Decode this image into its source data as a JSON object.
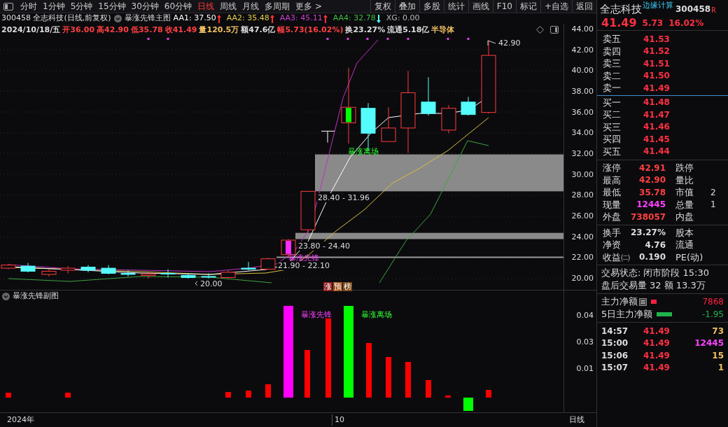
{
  "toolbar": {
    "periods": [
      {
        "label": "分时",
        "selected": false
      },
      {
        "label": "1分钟",
        "selected": false
      },
      {
        "label": "5分钟",
        "selected": false
      },
      {
        "label": "15分钟",
        "selected": false
      },
      {
        "label": "30分钟",
        "selected": false
      },
      {
        "label": "60分钟",
        "selected": false
      },
      {
        "label": "日线",
        "selected": true
      },
      {
        "label": "周线",
        "selected": false
      },
      {
        "label": "月线",
        "selected": false
      },
      {
        "label": "多周期",
        "selected": false
      },
      {
        "label": "更多 >",
        "selected": false
      }
    ],
    "actions": [
      "复权",
      "叠加",
      "多股",
      "统计",
      "画线",
      "F10",
      "标记",
      "+自选",
      "返回"
    ]
  },
  "info": {
    "title": "300458 全志科技(日线,前复权)",
    "indicator": "暴涨先锋主图",
    "values": [
      {
        "text": "AA1: 37.50",
        "color": "#ffffff",
        "rising": true
      },
      {
        "text": "AA2: 35.48",
        "color": "#e6d14a",
        "rising": true
      },
      {
        "text": "AA3: 45.11",
        "color": "#d13dd1",
        "rising": true
      },
      {
        "text": "AA4: 32.78",
        "color": "#3fbf3f",
        "rising": false
      },
      {
        "text": "XG: 0.00",
        "color": "#bbbbbb"
      }
    ],
    "quote": [
      {
        "text": "2024/10/18/五",
        "color": "#dddddd"
      },
      {
        "text": "开36.00",
        "color": "#ff4040"
      },
      {
        "text": "高42.90",
        "color": "#ff4040"
      },
      {
        "text": "低35.78",
        "color": "#ff4040"
      },
      {
        "text": "收41.49",
        "color": "#ff4040"
      },
      {
        "text": "量120.5万",
        "color": "#f0c060"
      },
      {
        "text": "额47.6亿",
        "color": "#dddddd"
      },
      {
        "text": "幅5.73(16.02%)",
        "color": "#ff4040"
      },
      {
        "text": "换23.27%",
        "color": "#dddddd"
      },
      {
        "text": "流通5.18亿",
        "color": "#dddddd"
      },
      {
        "text": "半导体",
        "color": "#f0c060"
      }
    ]
  },
  "main_chart": {
    "y_labels": [
      "44.00",
      "42.00",
      "40.00",
      "38.00",
      "36.00",
      "34.00",
      "32.00",
      "30.00",
      "28.00",
      "26.00",
      "24.00",
      "22.00",
      "20.00"
    ],
    "annotations": [
      {
        "text": "42.90",
        "kind": "price"
      },
      {
        "text": "暴涨离场",
        "kind": "exit"
      },
      {
        "text": "28.40 - 31.96",
        "kind": "range"
      },
      {
        "text": "23.80 - 24.40",
        "kind": "range"
      },
      {
        "text": "暴涨先锋",
        "kind": "entry"
      },
      {
        "text": "21.90 - 22.10",
        "kind": "range"
      },
      {
        "text": "20.00",
        "kind": "price"
      }
    ],
    "badges": [
      {
        "text": "涨",
        "color": "#8b1a1a"
      },
      {
        "text": "预",
        "color": "#a0521d"
      },
      {
        "text": "榜",
        "color": "#7a4a1a"
      }
    ]
  },
  "sub_chart": {
    "title": "暴涨先锋副图",
    "labels": [
      {
        "text": "暴涨先锋",
        "kind": "entry"
      },
      {
        "text": "暴涨离场",
        "kind": "exit"
      }
    ],
    "y_labels": [
      "0.04",
      "0.03",
      "0.01"
    ]
  },
  "time_axis": [
    "2024年",
    "10"
  ],
  "time_axis_mode": "日线",
  "quote_panel": {
    "name": "全志科技",
    "concept": "边缘计算",
    "code": "300458",
    "flag": "R",
    "price": "41.49",
    "change": "5.73",
    "change_pct": "16.02%",
    "asks": [
      {
        "label": "卖五",
        "price": "41.53"
      },
      {
        "label": "卖四",
        "price": "41.52"
      },
      {
        "label": "卖三",
        "price": "41.51"
      },
      {
        "label": "卖二",
        "price": "41.50"
      },
      {
        "label": "卖一",
        "price": "41.49"
      }
    ],
    "bids": [
      {
        "label": "买一",
        "price": "41.48"
      },
      {
        "label": "买二",
        "price": "41.47"
      },
      {
        "label": "买三",
        "price": "41.46"
      },
      {
        "label": "买四",
        "price": "41.45"
      },
      {
        "label": "买五",
        "price": "41.44"
      }
    ],
    "stats": [
      {
        "label": "涨停",
        "value": "42.91",
        "color": "#ff4040",
        "label_2": "跌停"
      },
      {
        "label": "最高",
        "value": "42.90",
        "color": "#ff4040",
        "label_2": "量比"
      },
      {
        "label": "最低",
        "value": "35.78",
        "color": "#ff4040",
        "label_2": "市值",
        "value_2": "2"
      },
      {
        "label": "现量",
        "value": "12445",
        "color": "#ff40ff",
        "label_2": "总量",
        "value_2": "1"
      },
      {
        "label": "外盘",
        "value": "738057",
        "color": "#ff4040",
        "label_2": "内盘"
      }
    ],
    "fundamentals": [
      {
        "label": "换手",
        "value": "23.27%",
        "label_2": "股本"
      },
      {
        "label": "净资",
        "value": "4.76",
        "label_2": "流通"
      },
      {
        "label": "收益㈡",
        "value": "0.190",
        "label_2": "PE(动)"
      }
    ],
    "session": [
      {
        "label": "交易状态:",
        "value": "闭市阶段 15:30"
      },
      {
        "label": "盘后交易量",
        "value": "32 额 13.3万"
      }
    ],
    "flows": [
      {
        "label": "主力净额",
        "value": "7868",
        "color": "#ff2040",
        "has_doc": true
      },
      {
        "label": "5日主力净额",
        "value": "-1.95",
        "color": "#1fb34a",
        "has_doc": false
      }
    ],
    "ticks": [
      {
        "time": "14:57",
        "price": "41.49",
        "volume": "73",
        "color": "#f0c060"
      },
      {
        "time": "15:00",
        "price": "41.49",
        "volume": "12445",
        "color": "#ff40ff"
      },
      {
        "time": "15:06",
        "price": "41.49",
        "volume": "15",
        "color": "#f0c060"
      },
      {
        "time": "15:07",
        "price": "41.49",
        "volume": "1",
        "color": "#f0c060"
      }
    ]
  }
}
